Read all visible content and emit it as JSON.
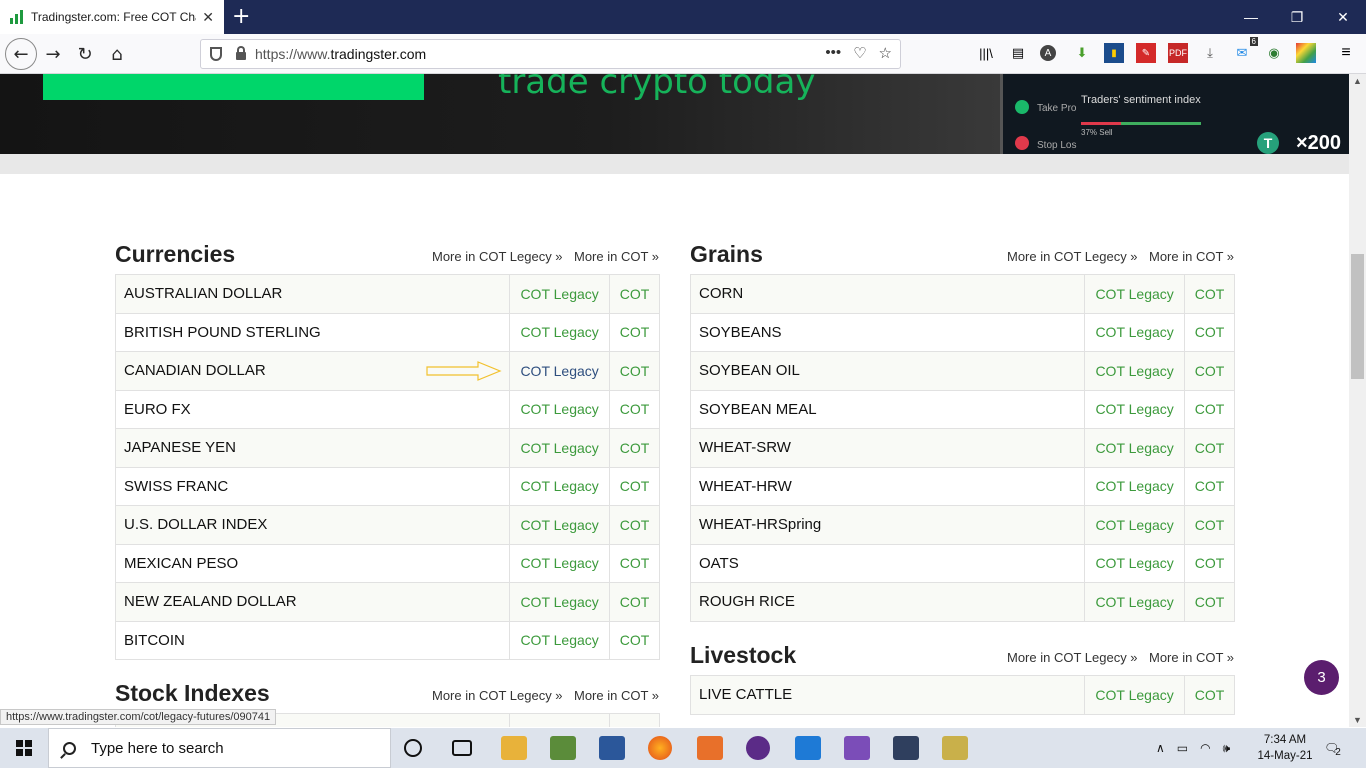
{
  "browser": {
    "tab_title": "Tradingster.com: Free COT Cha",
    "url_prefix": "https://www.",
    "url_domain": "tradingster.com"
  },
  "banner": {
    "slogan": "trade crypto today",
    "sentiment_label": "Traders' sentiment index",
    "sentiment_pct": "37% Sell",
    "take_profit": "Take Pro",
    "stop_loss": "Stop Los",
    "multiplier": "×200"
  },
  "sections": {
    "currencies": {
      "title": "Currencies",
      "more_legacy": "More in COT Legecy »",
      "more_cot": "More in COT »",
      "rows": [
        {
          "name": "AUSTRALIAN DOLLAR",
          "legacy": "COT Legacy",
          "cot": "COT"
        },
        {
          "name": "BRITISH POUND STERLING",
          "legacy": "COT Legacy",
          "cot": "COT"
        },
        {
          "name": "CANADIAN DOLLAR",
          "legacy": "COT Legacy",
          "cot": "COT"
        },
        {
          "name": "EURO FX",
          "legacy": "COT Legacy",
          "cot": "COT"
        },
        {
          "name": "JAPANESE YEN",
          "legacy": "COT Legacy",
          "cot": "COT"
        },
        {
          "name": "SWISS FRANC",
          "legacy": "COT Legacy",
          "cot": "COT"
        },
        {
          "name": "U.S. DOLLAR INDEX",
          "legacy": "COT Legacy",
          "cot": "COT"
        },
        {
          "name": "MEXICAN PESO",
          "legacy": "COT Legacy",
          "cot": "COT"
        },
        {
          "name": "NEW ZEALAND DOLLAR",
          "legacy": "COT Legacy",
          "cot": "COT"
        },
        {
          "name": "BITCOIN",
          "legacy": "COT Legacy",
          "cot": "COT"
        }
      ]
    },
    "grains": {
      "title": "Grains",
      "more_legacy": "More in COT Legecy »",
      "more_cot": "More in COT »",
      "rows": [
        {
          "name": "CORN",
          "legacy": "COT Legacy",
          "cot": "COT"
        },
        {
          "name": "SOYBEANS",
          "legacy": "COT Legacy",
          "cot": "COT"
        },
        {
          "name": "SOYBEAN OIL",
          "legacy": "COT Legacy",
          "cot": "COT"
        },
        {
          "name": "SOYBEAN MEAL",
          "legacy": "COT Legacy",
          "cot": "COT"
        },
        {
          "name": "WHEAT-SRW",
          "legacy": "COT Legacy",
          "cot": "COT"
        },
        {
          "name": "WHEAT-HRW",
          "legacy": "COT Legacy",
          "cot": "COT"
        },
        {
          "name": "WHEAT-HRSpring",
          "legacy": "COT Legacy",
          "cot": "COT"
        },
        {
          "name": "OATS",
          "legacy": "COT Legacy",
          "cot": "COT"
        },
        {
          "name": "ROUGH RICE",
          "legacy": "COT Legacy",
          "cot": "COT"
        }
      ]
    },
    "livestock": {
      "title": "Livestock",
      "more_legacy": "More in COT Legecy »",
      "more_cot": "More in COT »",
      "rows": [
        {
          "name": "LIVE CATTLE",
          "legacy": "COT Legacy",
          "cot": "COT"
        }
      ]
    },
    "stock_indexes": {
      "title": "Stock Indexes",
      "more_legacy": "More in COT Legecy »",
      "more_cot": "More in COT »"
    }
  },
  "status_link": "https://www.tradingster.com/cot/legacy-futures/090741",
  "chat_badge": "3",
  "toolbar_badge": "6",
  "taskbar": {
    "search_placeholder": "Type here to search",
    "time": "7:34 AM",
    "date": "14-May-21",
    "notifications": "2"
  },
  "colors": {
    "link_green": "#3c9a3c",
    "link_hover": "#2f4f7f",
    "arrow": "#f2c12e",
    "titlebar": "#1e2a55"
  }
}
